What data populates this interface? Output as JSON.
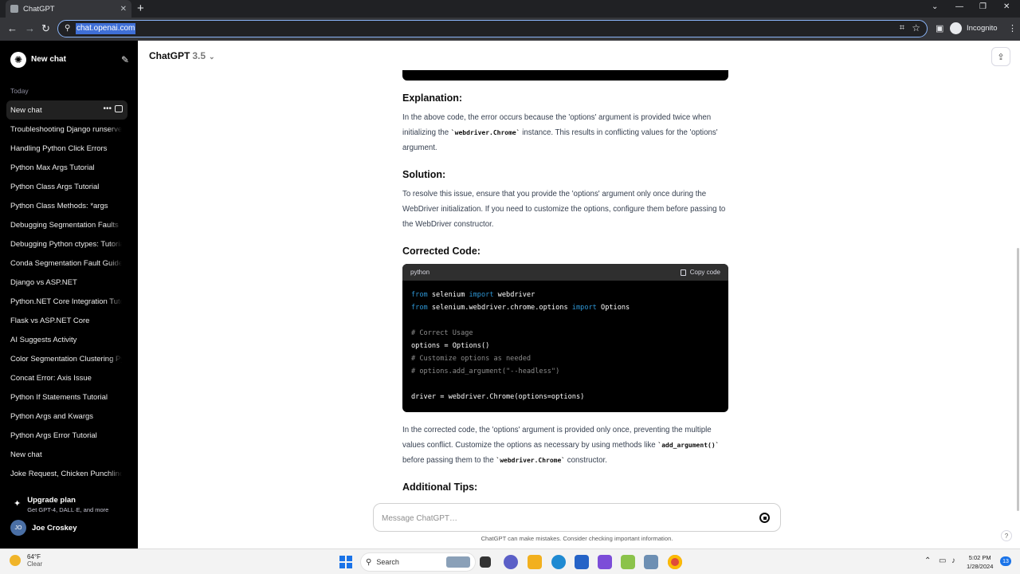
{
  "browser": {
    "tab_title": "ChatGPT",
    "tab_close": "✕",
    "new_tab": "+",
    "url": "chat.openai.com",
    "incognito_label": "Incognito",
    "window_controls": [
      "⌄",
      "—",
      "❐",
      "✕"
    ]
  },
  "sidebar": {
    "new_chat_label": "New chat",
    "section_label": "Today",
    "items": [
      "New chat",
      "Troubleshooting Django runserver",
      "Handling Python Click Errors",
      "Python Max Args Tutorial",
      "Python Class Args Tutorial",
      "Python Class Methods: *args",
      "Debugging Segmentation Faults",
      "Debugging Python ctypes: Tutorial",
      "Conda Segmentation Fault Guide",
      "Django vs ASP.NET",
      "Python.NET Core Integration Tutorial",
      "Flask vs ASP.NET Core",
      "AI Suggests Activity",
      "Color Segmentation Clustering Python",
      "Concat Error: Axis Issue",
      "Python If Statements Tutorial",
      "Python Args and Kwargs",
      "Python Args Error Tutorial",
      "New chat",
      "Joke Request, Chicken Punchline"
    ],
    "upgrade_title": "Upgrade plan",
    "upgrade_subtitle": "Get GPT-4, DALL·E, and more",
    "user_initials": "JO",
    "user_name": "Joe Croskey"
  },
  "header": {
    "model_name": "ChatGPT",
    "model_version": "3.5",
    "model_chevron": "⌄"
  },
  "content": {
    "explanation_heading": "Explanation:",
    "explanation_p1": "In the above code, the error occurs because the 'options' argument is provided twice when initializing the ",
    "explanation_code": "`webdriver.Chrome`",
    "explanation_p2": " instance. This results in conflicting values for the 'options' argument.",
    "solution_heading": "Solution:",
    "solution_text": "To resolve this issue, ensure that you provide the 'options' argument only once during the WebDriver initialization. If you need to customize the options, configure them before passing to the WebDriver constructor.",
    "corrected_heading": "Corrected Code:",
    "code_language": "python",
    "copy_label": "Copy code",
    "code_lines": [
      [
        {
          "t": "from",
          "c": "kw"
        },
        {
          "t": " selenium "
        },
        {
          "t": "import",
          "c": "kw"
        },
        {
          "t": " webdriver"
        }
      ],
      [
        {
          "t": "from",
          "c": "kw"
        },
        {
          "t": " selenium.webdriver.chrome.options "
        },
        {
          "t": "import",
          "c": "kw"
        },
        {
          "t": " Options"
        }
      ],
      [],
      [
        {
          "t": "# Correct Usage",
          "c": "cm"
        }
      ],
      [
        {
          "t": "options = Options()"
        }
      ],
      [
        {
          "t": "# Customize options as needed",
          "c": "cm"
        }
      ],
      [
        {
          "t": "# options.add_argument(\"--headless\")",
          "c": "cm"
        }
      ],
      [],
      [
        {
          "t": "driver = webdriver.Chrome(options=options)"
        }
      ]
    ],
    "after_p1": "In the corrected code, the 'options' argument is provided only once, preventing the multiple values conflict. Customize the options as necessary by using methods like ",
    "after_code1": "`add_argument()`",
    "after_p2": " before passing them to the ",
    "after_code2": "`webdriver.Chrome`",
    "after_p3": " constructor.",
    "tips_heading": "Additional Tips:"
  },
  "composer": {
    "placeholder": "Message ChatGPT…",
    "disclaimer": "ChatGPT can make mistakes. Consider checking important information.",
    "help": "?"
  },
  "taskbar": {
    "temperature": "64°F",
    "condition": "Clear",
    "search_label": "Search",
    "time": "5:02 PM",
    "date": "1/28/2024",
    "notification_count": "13"
  },
  "colors": {
    "accent_blue": "#2e95d3",
    "sidebar_bg": "#000000",
    "omnibox_focus": "#8ab4f8"
  }
}
